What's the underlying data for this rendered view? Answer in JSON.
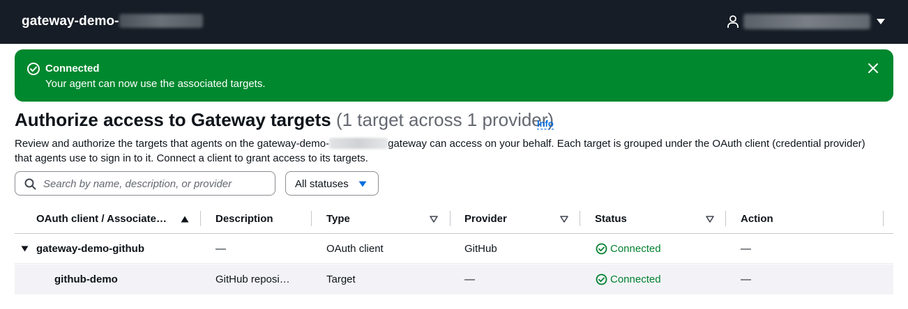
{
  "topbar": {
    "title": "gateway-demo-",
    "user_icon": "user-icon",
    "menu_icon": "caret-down-icon"
  },
  "flash": {
    "icon": "check-circle-icon",
    "title": "Connected",
    "message": "Your agent can now use the associated targets.",
    "close_icon": "close-icon",
    "color": "#00882f"
  },
  "page": {
    "heading": "Authorize access to Gateway targets",
    "count": "(1 target across 1 provider)",
    "info_label": "Info",
    "description_before": "Review and authorize the targets that agents on the gateway-demo-",
    "description_after": "gateway can access on your behalf. Each target is grouped under the OAuth client (credential provider) that agents use to sign in to it. Connect a client to grant access to its targets."
  },
  "filter": {
    "search_placeholder": "Search by name, description, or provider",
    "search_value": "",
    "status_selected": "All statuses"
  },
  "table": {
    "columns": [
      "OAuth client / Associate…",
      "Description",
      "Type",
      "Provider",
      "Status",
      "Action"
    ],
    "rows": [
      {
        "name": "gateway-demo-github",
        "description": "—",
        "type": "OAuth client",
        "provider": "GitHub",
        "status": "Connected",
        "action": "—"
      },
      {
        "name": "github-demo",
        "description": "GitHub reposi…",
        "type": "Target",
        "provider": "—",
        "status": "Connected",
        "action": "—"
      }
    ]
  },
  "colors": {
    "topbar_bg": "#161d26",
    "success": "#00802f",
    "link": "#006ce0"
  }
}
